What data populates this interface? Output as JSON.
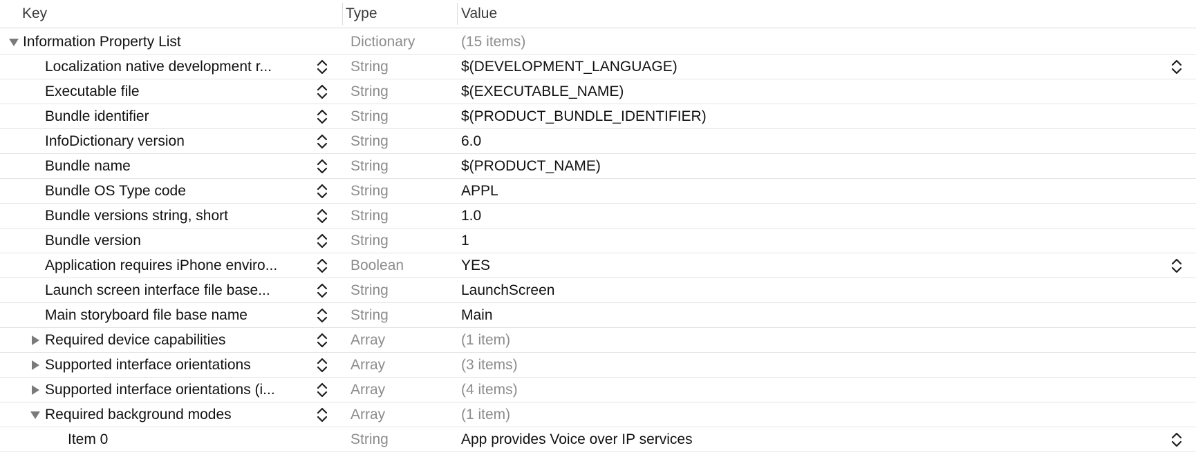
{
  "header": {
    "key_label": "Key",
    "type_label": "Type",
    "value_label": "Value"
  },
  "rows": [
    {
      "level": 0,
      "key": "Information Property List",
      "type": "Dictionary",
      "value": "(15 items)",
      "value_dim": true,
      "disclosure": "expanded",
      "stepper": false,
      "popup": false
    },
    {
      "level": 1,
      "key": "Localization native development r...",
      "type": "String",
      "value": "$(DEVELOPMENT_LANGUAGE)",
      "value_dim": false,
      "disclosure": "none",
      "stepper": true,
      "popup": true
    },
    {
      "level": 1,
      "key": "Executable file",
      "type": "String",
      "value": "$(EXECUTABLE_NAME)",
      "value_dim": false,
      "disclosure": "none",
      "stepper": true,
      "popup": false
    },
    {
      "level": 1,
      "key": "Bundle identifier",
      "type": "String",
      "value": "$(PRODUCT_BUNDLE_IDENTIFIER)",
      "value_dim": false,
      "disclosure": "none",
      "stepper": true,
      "popup": false
    },
    {
      "level": 1,
      "key": "InfoDictionary version",
      "type": "String",
      "value": "6.0",
      "value_dim": false,
      "disclosure": "none",
      "stepper": true,
      "popup": false
    },
    {
      "level": 1,
      "key": "Bundle name",
      "type": "String",
      "value": "$(PRODUCT_NAME)",
      "value_dim": false,
      "disclosure": "none",
      "stepper": true,
      "popup": false
    },
    {
      "level": 1,
      "key": "Bundle OS Type code",
      "type": "String",
      "value": "APPL",
      "value_dim": false,
      "disclosure": "none",
      "stepper": true,
      "popup": false
    },
    {
      "level": 1,
      "key": "Bundle versions string, short",
      "type": "String",
      "value": "1.0",
      "value_dim": false,
      "disclosure": "none",
      "stepper": true,
      "popup": false
    },
    {
      "level": 1,
      "key": "Bundle version",
      "type": "String",
      "value": "1",
      "value_dim": false,
      "disclosure": "none",
      "stepper": true,
      "popup": false
    },
    {
      "level": 1,
      "key": "Application requires iPhone enviro...",
      "type": "Boolean",
      "value": "YES",
      "value_dim": false,
      "disclosure": "none",
      "stepper": true,
      "popup": true
    },
    {
      "level": 1,
      "key": "Launch screen interface file base...",
      "type": "String",
      "value": "LaunchScreen",
      "value_dim": false,
      "disclosure": "none",
      "stepper": true,
      "popup": false
    },
    {
      "level": 1,
      "key": "Main storyboard file base name",
      "type": "String",
      "value": "Main",
      "value_dim": false,
      "disclosure": "none",
      "stepper": true,
      "popup": false
    },
    {
      "level": 1,
      "key": "Required device capabilities",
      "type": "Array",
      "value": "(1 item)",
      "value_dim": true,
      "disclosure": "collapsed",
      "stepper": true,
      "popup": false
    },
    {
      "level": 1,
      "key": "Supported interface orientations",
      "type": "Array",
      "value": "(3 items)",
      "value_dim": true,
      "disclosure": "collapsed",
      "stepper": true,
      "popup": false
    },
    {
      "level": 1,
      "key": "Supported interface orientations (i...",
      "type": "Array",
      "value": "(4 items)",
      "value_dim": true,
      "disclosure": "collapsed",
      "stepper": true,
      "popup": false
    },
    {
      "level": 1,
      "key": "Required background modes",
      "type": "Array",
      "value": "(1 item)",
      "value_dim": true,
      "disclosure": "expanded",
      "stepper": true,
      "popup": false
    },
    {
      "level": 2,
      "key": "Item 0",
      "type": "String",
      "value": "App provides Voice over IP services",
      "value_dim": false,
      "disclosure": "none",
      "stepper": false,
      "popup": true
    }
  ]
}
